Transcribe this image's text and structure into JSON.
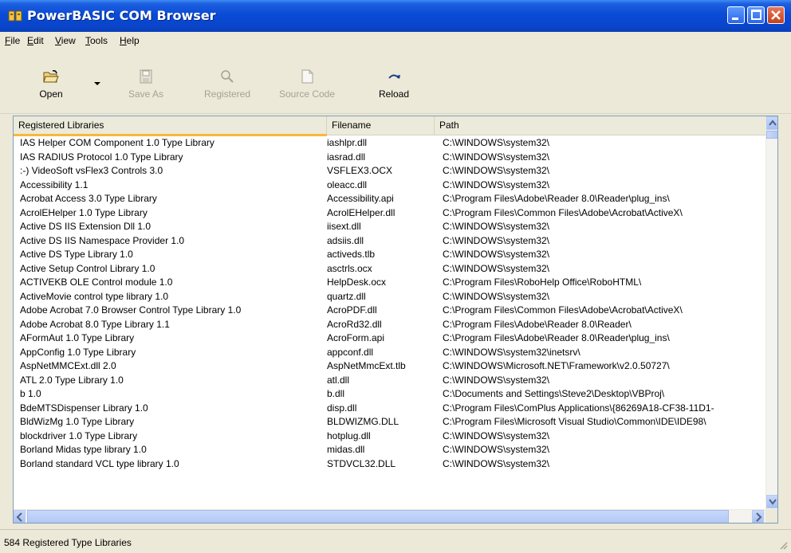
{
  "window": {
    "title": "PowerBASIC COM Browser"
  },
  "menu": {
    "items": [
      {
        "first": "F",
        "rest": "ile"
      },
      {
        "first": "E",
        "rest": "dit"
      },
      {
        "first": "V",
        "rest": "iew"
      },
      {
        "first": "T",
        "rest": "ools"
      },
      {
        "first": "H",
        "rest": "elp"
      }
    ]
  },
  "toolbar": {
    "open": "Open",
    "save_as": "Save As",
    "registered": "Registered",
    "source_code": "Source Code",
    "reload": "Reload"
  },
  "table": {
    "headers": [
      "Registered Libraries",
      "Filename",
      "Path"
    ],
    "rows": [
      [
        "IAS Helper COM Component 1.0 Type Library",
        "iashlpr.dll",
        "C:\\WINDOWS\\system32\\"
      ],
      [
        "IAS RADIUS Protocol 1.0 Type Library",
        "iasrad.dll",
        "C:\\WINDOWS\\system32\\"
      ],
      [
        ":-) VideoSoft vsFlex3 Controls 3.0",
        "VSFLEX3.OCX",
        "C:\\WINDOWS\\system32\\"
      ],
      [
        "Accessibility 1.1",
        "oleacc.dll",
        "C:\\WINDOWS\\system32\\"
      ],
      [
        "Acrobat Access 3.0 Type Library",
        "Accessibility.api",
        "C:\\Program Files\\Adobe\\Reader 8.0\\Reader\\plug_ins\\"
      ],
      [
        "AcrolEHelper 1.0 Type Library",
        "AcrolEHelper.dll",
        "C:\\Program Files\\Common Files\\Adobe\\Acrobat\\ActiveX\\"
      ],
      [
        "Active DS IIS Extension Dll 1.0",
        "iisext.dll",
        "C:\\WINDOWS\\system32\\"
      ],
      [
        "Active DS IIS Namespace Provider 1.0",
        "adsiis.dll",
        "C:\\WINDOWS\\system32\\"
      ],
      [
        "Active DS Type Library 1.0",
        "activeds.tlb",
        "C:\\WINDOWS\\system32\\"
      ],
      [
        "Active Setup Control Library 1.0",
        "asctrls.ocx",
        "C:\\WINDOWS\\system32\\"
      ],
      [
        "ACTIVEKB OLE Control module 1.0",
        "HelpDesk.ocx",
        "C:\\Program Files\\RoboHelp Office\\RoboHTML\\"
      ],
      [
        "ActiveMovie control type library 1.0",
        "quartz.dll",
        "C:\\WINDOWS\\system32\\"
      ],
      [
        "Adobe Acrobat 7.0 Browser Control Type Library 1.0",
        "AcroPDF.dll",
        "C:\\Program Files\\Common Files\\Adobe\\Acrobat\\ActiveX\\"
      ],
      [
        "Adobe Acrobat 8.0 Type Library 1.1",
        "AcroRd32.dll",
        "C:\\Program Files\\Adobe\\Reader 8.0\\Reader\\"
      ],
      [
        "AFormAut 1.0 Type Library",
        "AcroForm.api",
        "C:\\Program Files\\Adobe\\Reader 8.0\\Reader\\plug_ins\\"
      ],
      [
        "AppConfig 1.0 Type Library",
        "appconf.dll",
        "C:\\WINDOWS\\system32\\inetsrv\\"
      ],
      [
        "AspNetMMCExt.dll 2.0",
        "AspNetMmcExt.tlb",
        "C:\\WINDOWS\\Microsoft.NET\\Framework\\v2.0.50727\\"
      ],
      [
        "ATL 2.0 Type Library 1.0",
        "atl.dll",
        "C:\\WINDOWS\\system32\\"
      ],
      [
        "b 1.0",
        "b.dll",
        "C:\\Documents and Settings\\Steve2\\Desktop\\VBProj\\"
      ],
      [
        "BdeMTSDispenser Library 1.0",
        "disp.dll",
        "C:\\Program Files\\ComPlus Applications\\{86269A18-CF38-11D1-"
      ],
      [
        "BldWizMg 1.0 Type Library",
        "BLDWIZMG.DLL",
        "C:\\Program Files\\Microsoft Visual Studio\\Common\\IDE\\IDE98\\"
      ],
      [
        "blockdriver 1.0 Type Library",
        "hotplug.dll",
        "C:\\WINDOWS\\system32\\"
      ],
      [
        "Borland Midas type library 1.0",
        "midas.dll",
        "C:\\WINDOWS\\system32\\"
      ],
      [
        "Borland standard VCL type library 1.0",
        "STDVCL32.DLL",
        "C:\\WINDOWS\\system32\\"
      ]
    ]
  },
  "status": {
    "text": "584 Registered Type Libraries"
  }
}
